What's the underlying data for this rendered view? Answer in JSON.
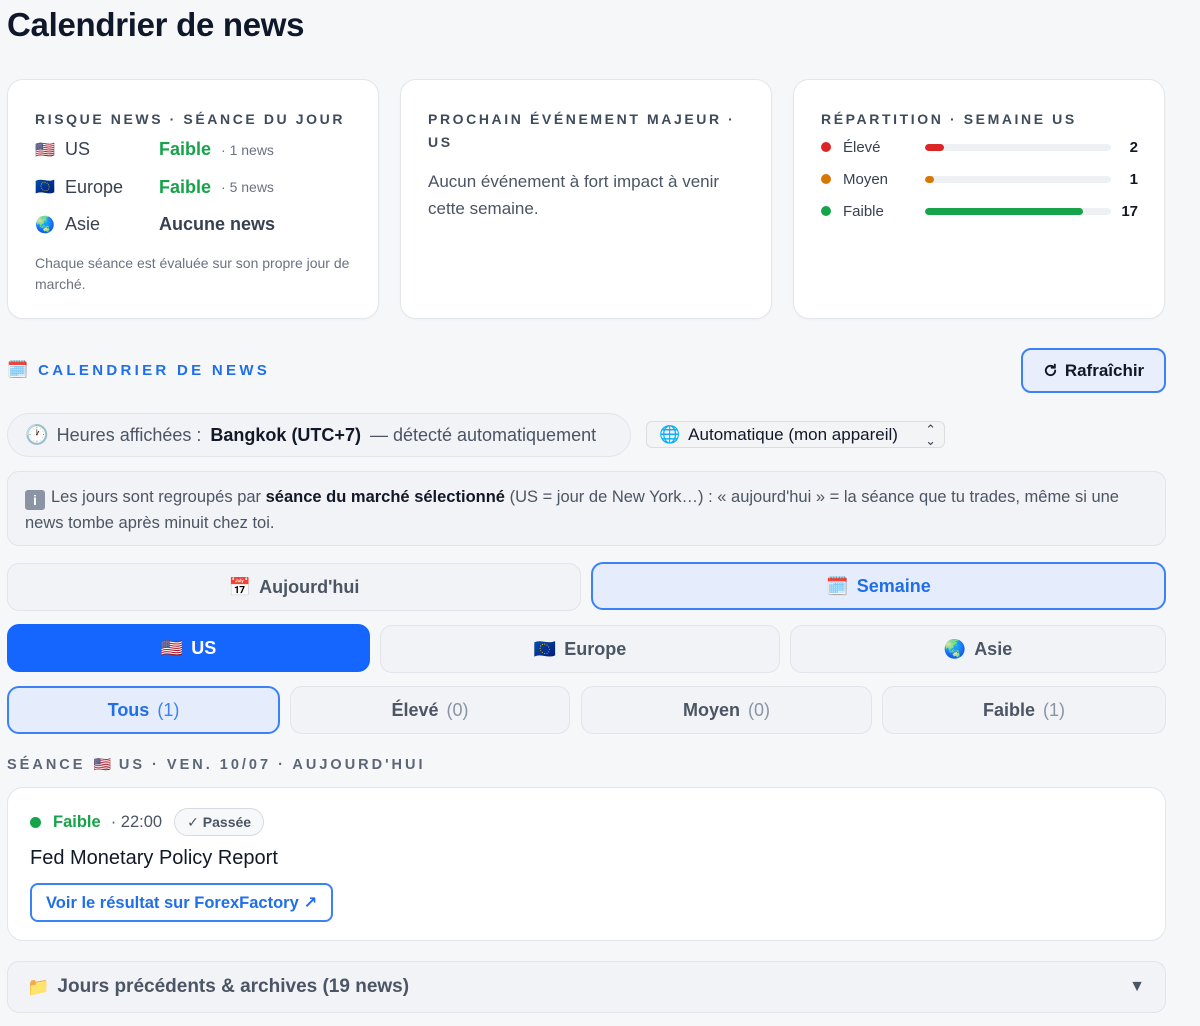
{
  "page": {
    "title": "Calendrier de news"
  },
  "risk_card": {
    "label": "RISQUE NEWS · SÉANCE DU JOUR",
    "rows": [
      {
        "flag": "🇺🇸",
        "name": "US",
        "level": "Faible",
        "count": "· 1 news"
      },
      {
        "flag": "🇪🇺",
        "name": "Europe",
        "level": "Faible",
        "count": "· 5 news"
      },
      {
        "flag": "🌏",
        "name": "Asie",
        "level": "Aucune news",
        "count": ""
      }
    ],
    "note": "Chaque séance est évaluée sur son propre jour de marché."
  },
  "next_card": {
    "label": "PROCHAIN ÉVÉNEMENT MAJEUR · US",
    "text": "Aucun événement à fort impact à venir cette semaine."
  },
  "distribution_card": {
    "label": "RÉPARTITION · SEMAINE US",
    "rows": [
      {
        "name": "Élevé",
        "count": "2",
        "color": "#dc2626",
        "fraction": 0.1
      },
      {
        "name": "Moyen",
        "count": "1",
        "color": "#d97706",
        "fraction": 0.05
      },
      {
        "name": "Faible",
        "count": "17",
        "color": "#16a34a",
        "fraction": 0.85
      }
    ]
  },
  "calendar": {
    "section_icon": "🗓️",
    "section_title": "CALENDRIER DE NEWS",
    "refresh_label": "Rafraîchir",
    "timezone": {
      "prefix": "Heures affichées :",
      "value": "Bangkok (UTC+7)",
      "suffix": "— détecté automatiquement",
      "select_value": "Automatique (mon appareil)"
    },
    "info": {
      "part1": "Les jours sont regroupés par ",
      "bold": "séance du marché sélectionné",
      "part2": " (US = jour de New York…) : « aujourd'hui » = la séance que tu trades, même si une news tombe après minuit chez toi."
    },
    "period_tabs": [
      {
        "icon": "📅",
        "label": "Aujourd'hui"
      },
      {
        "icon": "🗓️",
        "label": "Semaine"
      }
    ],
    "market_tabs": [
      {
        "flag": "🇺🇸",
        "label": "US"
      },
      {
        "flag": "🇪🇺",
        "label": "Europe"
      },
      {
        "flag": "🌏",
        "label": "Asie"
      }
    ],
    "impact_tabs": [
      {
        "label": "Tous",
        "count": "(1)"
      },
      {
        "label": "Élevé",
        "count": "(0)"
      },
      {
        "label": "Moyen",
        "count": "(0)"
      },
      {
        "label": "Faible",
        "count": "(1)"
      }
    ],
    "session": {
      "prefix": "SÉANCE",
      "flag": "🇺🇸",
      "rest": "US · VEN. 10/07 · AUJOURD'HUI"
    },
    "news": [
      {
        "impact": "Faible",
        "time": "· 22:00",
        "status": "Passée",
        "title": "Fed Monetary Policy Report",
        "link_label": "Voir le résultat sur ForexFactory ↗"
      }
    ],
    "archive": {
      "icon": "📁",
      "label": "Jours précédents & archives (19 news)",
      "toggle": "▼"
    }
  }
}
